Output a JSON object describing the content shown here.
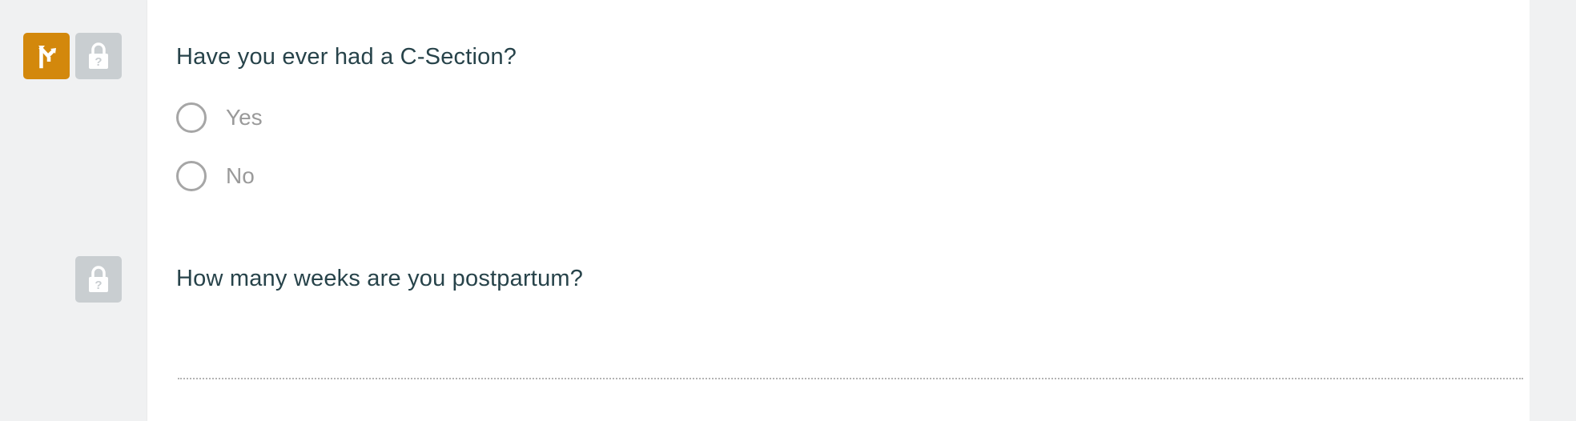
{
  "questions": [
    {
      "text": "Have you ever had a C-Section?",
      "type": "radio",
      "options": [
        "Yes",
        "No"
      ],
      "badges": [
        "branch-logic-icon",
        "locked-question-icon"
      ]
    },
    {
      "text": "How many weeks are you postpartum?",
      "type": "text",
      "value": "",
      "placeholder": "",
      "badges": [
        "locked-question-icon"
      ]
    }
  ],
  "colors": {
    "branch_badge": "#d3880c",
    "lock_badge": "#c9ced1",
    "question_text": "#27434a",
    "option_text": "#9a9a9a",
    "background": "#f0f1f2"
  }
}
